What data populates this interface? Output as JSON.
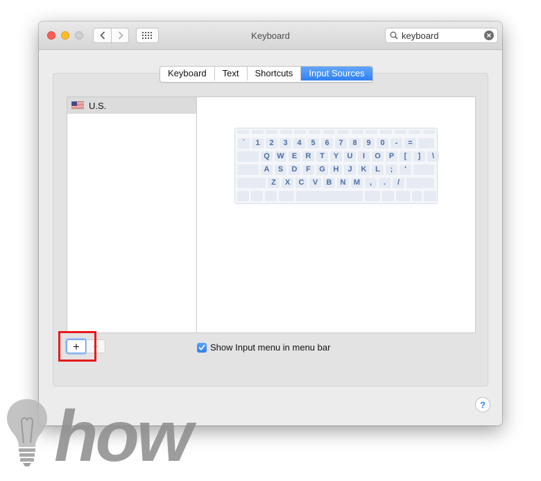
{
  "window": {
    "title": "Keyboard"
  },
  "search": {
    "value": "keyboard"
  },
  "tabs": [
    {
      "label": "Keyboard",
      "active": false
    },
    {
      "label": "Text",
      "active": false
    },
    {
      "label": "Shortcuts",
      "active": false
    },
    {
      "label": "Input Sources",
      "active": true
    }
  ],
  "input_sources": [
    {
      "label": "U.S.",
      "icon": "us-flag-icon",
      "selected": true
    }
  ],
  "keyboard_rows": [
    [
      "`",
      "1",
      "2",
      "3",
      "4",
      "5",
      "6",
      "7",
      "8",
      "9",
      "0",
      "-",
      "="
    ],
    [
      "Q",
      "W",
      "E",
      "R",
      "T",
      "Y",
      "U",
      "I",
      "O",
      "P",
      "[",
      "]",
      "\\"
    ],
    [
      "A",
      "S",
      "D",
      "F",
      "G",
      "H",
      "J",
      "K",
      "L",
      ";",
      "'"
    ],
    [
      "Z",
      "X",
      "C",
      "V",
      "B",
      "N",
      "M",
      ",",
      ".",
      "/"
    ]
  ],
  "controls": {
    "add_label": "+",
    "remove_label": "−"
  },
  "show_input_menu": {
    "label": "Show Input menu in menu bar",
    "checked": true
  },
  "help": {
    "label": "?"
  },
  "watermark": {
    "text": "how"
  },
  "colors": {
    "accent": "#2f80f2",
    "highlight": "#e8191b"
  }
}
